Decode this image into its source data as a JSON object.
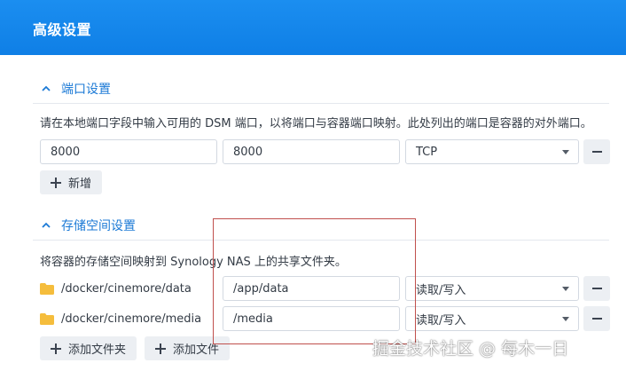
{
  "header": {
    "title": "高级设置"
  },
  "port_section": {
    "title": "端口设置",
    "description": "请在本地端口字段中输入可用的 DSM 端口，以将端口与容器端口映射。此处列出的端口是容器的对外端口。",
    "rows": [
      {
        "local_port": "8000",
        "container_port": "8000",
        "protocol": "TCP"
      }
    ],
    "add_label": "新增"
  },
  "storage_section": {
    "title": "存储空间设置",
    "description": "将容器的存储空间映射到 Synology NAS 上的共享文件夹。",
    "rows": [
      {
        "folder": "/docker/cinemore/data",
        "mount_path": "/app/data",
        "permission": "读取/写入"
      },
      {
        "folder": "/docker/cinemore/media",
        "mount_path": "/media",
        "permission": "读取/写入"
      }
    ],
    "add_folder_label": "添加文件夹",
    "add_file_label": "添加文件"
  },
  "watermark": "掘金技术社区 @ 每木一日",
  "colors": {
    "header": "#0f7fe6",
    "accent": "#1c7ad6",
    "folder": "#f5bd3c",
    "highlight_box": "#c0504d"
  }
}
